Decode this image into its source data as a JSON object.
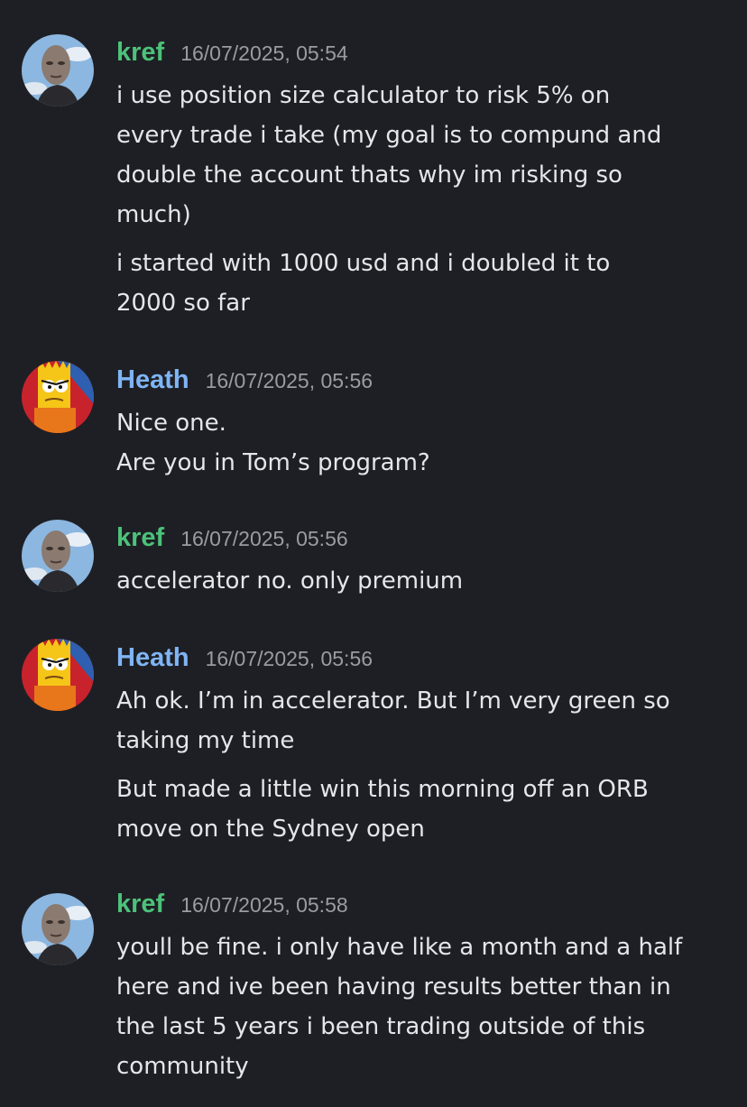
{
  "colors": {
    "background": "#1e1f24",
    "kref_name": "#4cc27a",
    "heath_name": "#7fb5f5",
    "timestamp": "#9a9ca3",
    "text": "#e4e6ea"
  },
  "messages": [
    {
      "author": "kref",
      "timestamp": "16/07/2025, 05:54",
      "avatar": "alien-portrait-avatar",
      "lines": [
        "i use position size calculator to risk 5% on",
        "every trade i take (my goal is to compund and",
        "double the account thats why im risking so",
        "much)",
        "i started with 1000 usd and i doubled it to",
        "2000 so far"
      ]
    },
    {
      "author": "Heath",
      "timestamp": "16/07/2025, 05:56",
      "avatar": "bart-simpson-avatar",
      "lines": [
        "Nice one.",
        "Are you in Tom’s program?"
      ]
    },
    {
      "author": "kref",
      "timestamp": "16/07/2025, 05:56",
      "avatar": "alien-portrait-avatar",
      "lines": [
        "accelerator no. only premium"
      ]
    },
    {
      "author": "Heath",
      "timestamp": "16/07/2025, 05:56",
      "avatar": "bart-simpson-avatar",
      "lines": [
        "Ah ok. I’m in accelerator. But I’m very green so",
        "taking my time",
        "But made a little win this morning off an ORB",
        "move on the Sydney open"
      ]
    },
    {
      "author": "kref",
      "timestamp": "16/07/2025, 05:58",
      "avatar": "alien-portrait-avatar",
      "lines": [
        "youll be fine. i only have like a month and a half",
        "here and ive been having results better than in",
        "the last 5 years i been trading outside of this",
        "community"
      ]
    }
  ]
}
